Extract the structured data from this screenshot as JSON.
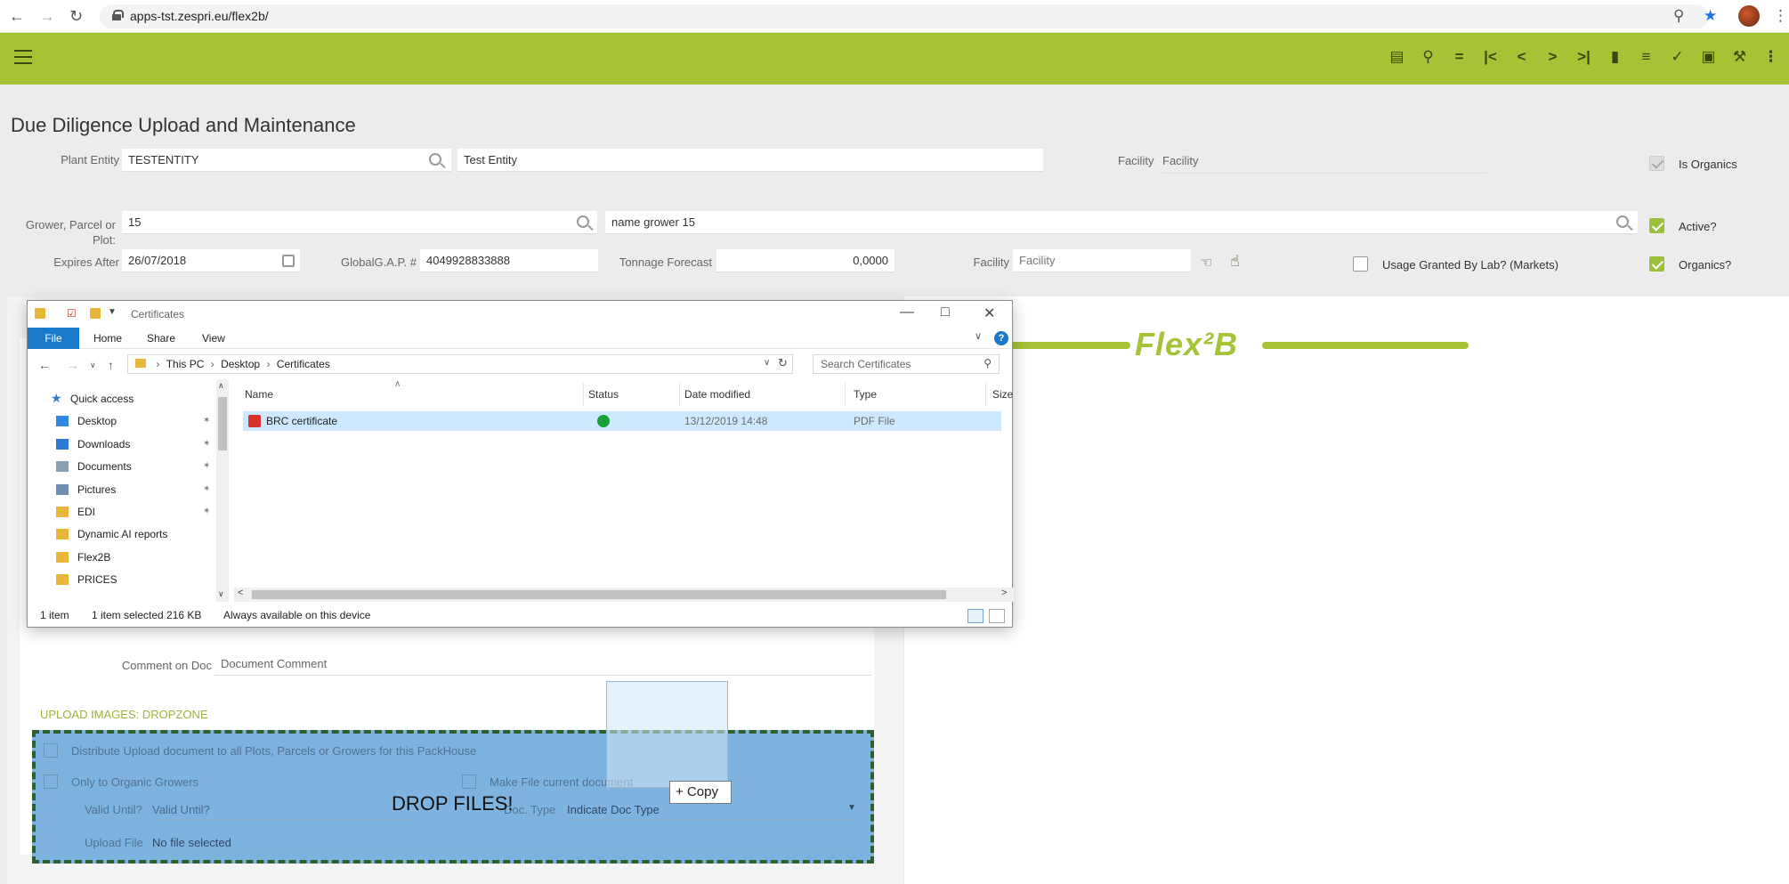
{
  "browser": {
    "url": "apps-tst.zespri.eu/flex2b/"
  },
  "app": {
    "page_title": "Due Diligence Upload and Maintenance",
    "brand_logo": "Flex²B"
  },
  "form": {
    "plant_entity_label": "Plant Entity",
    "plant_entity_code": "TESTENTITY",
    "plant_entity_name": "Test Entity",
    "facility_top_label": "Facility",
    "facility_top_value": "Facility",
    "is_organics_label": "Is Organics",
    "grower_label_line1": "Grower, Parcel or",
    "grower_label_line2": "Plot",
    "grower_code": "15",
    "grower_name": "name grower 15",
    "active_label": "Active?",
    "expires_label": "Expires After",
    "expires_value": "26/07/2018",
    "globalgap_label": "GlobalG.A.P. #",
    "globalgap_value": "4049928833888",
    "tonnage_label": "Tonnage Forecast",
    "tonnage_value": "0,0000",
    "facility_label": "Facility",
    "facility_placeholder": "Facility",
    "usage_label": "Usage Granted By Lab? (Markets)",
    "organics_label": "Organics?",
    "comment_label": "Comment on Doc",
    "comment_placeholder": "Document Comment"
  },
  "upload": {
    "section_title": "UPLOAD IMAGES: DROPZONE",
    "distribute_label": "Distribute Upload document to all Plots, Parcels or Growers for this PackHouse",
    "organic_only_label": "Only to Organic Growers",
    "make_current_label": "Make File current document",
    "valid_until_label": "Valid Until?",
    "valid_until_placeholder": "Valid Until?",
    "doc_type_label": "Doc. Type",
    "doc_type_value": "Indicate Doc Type",
    "upload_file_label": "Upload File",
    "upload_file_value": "No file selected",
    "drop_text": "DROP FILES!",
    "copy_tip": "+ Copy"
  },
  "explorer": {
    "title": "Certificates",
    "ribbon_tabs": [
      "File",
      "Home",
      "Share",
      "View"
    ],
    "breadcrumb": [
      "This PC",
      "Desktop",
      "Certificates"
    ],
    "search_placeholder": "Search Certificates",
    "nav_items": [
      {
        "label": "Quick access",
        "icon": "star-icon",
        "pinned": false
      },
      {
        "label": "Desktop",
        "icon": "desktop-icon",
        "pinned": true
      },
      {
        "label": "Downloads",
        "icon": "download-icon",
        "pinned": true
      },
      {
        "label": "Documents",
        "icon": "documents-icon",
        "pinned": true
      },
      {
        "label": "Pictures",
        "icon": "pictures-icon",
        "pinned": true
      },
      {
        "label": "EDI",
        "icon": "folder-icon",
        "pinned": true
      },
      {
        "label": "Dynamic AI reports",
        "icon": "folder-icon",
        "pinned": false
      },
      {
        "label": "Flex2B",
        "icon": "folder-icon",
        "pinned": false
      },
      {
        "label": "PRICES",
        "icon": "folder-icon",
        "pinned": false
      }
    ],
    "columns": [
      "Name",
      "Status",
      "Date modified",
      "Type",
      "Size"
    ],
    "files": [
      {
        "name": "BRC certificate",
        "status": "ok",
        "date_modified": "13/12/2019 14:48",
        "type": "PDF File"
      }
    ],
    "status_count": "1 item",
    "status_selected": "1 item selected  216 KB",
    "status_availability": "Always available on this device"
  },
  "colors": {
    "brand_green": "#a6c235",
    "check_green": "#9bc13c",
    "dropzone_blue": "#6ca8dc",
    "explorer_blue": "#1979ca"
  }
}
